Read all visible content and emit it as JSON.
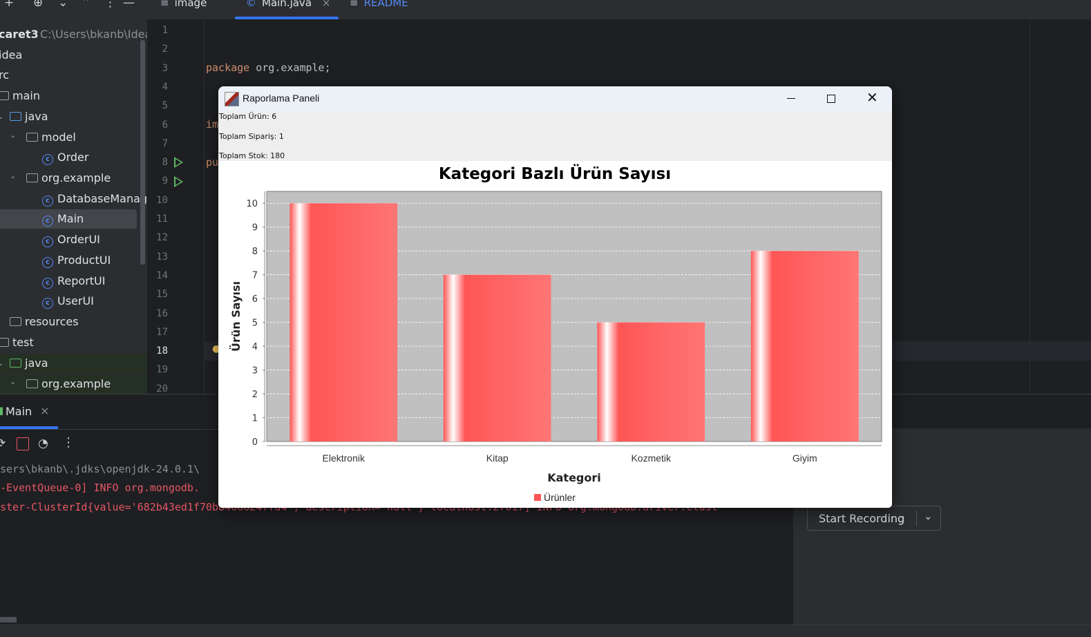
{
  "toolbar": {
    "tabs": [
      {
        "label": "image",
        "icon": "lines-icon"
      },
      {
        "label": "Main.java",
        "icon": "class-icon"
      },
      {
        "label": "README",
        "icon": "lines-icon"
      }
    ]
  },
  "project_tree": {
    "root_label": "caret3",
    "root_path": "C:\\Users\\bkanb\\Idea",
    "items": [
      {
        "label": "idea"
      },
      {
        "label": "rc"
      },
      {
        "label": "main"
      },
      {
        "label": "java"
      },
      {
        "label": "model"
      },
      {
        "label": "Order"
      },
      {
        "label": "org.example"
      },
      {
        "label": "DatabaseManage"
      },
      {
        "label": "Main"
      },
      {
        "label": "OrderUI"
      },
      {
        "label": "ProductUI"
      },
      {
        "label": "ReportUI"
      },
      {
        "label": "UserUI"
      },
      {
        "label": "resources"
      },
      {
        "label": "test"
      },
      {
        "label": "java"
      },
      {
        "label": "org.example"
      }
    ]
  },
  "editor": {
    "line_numbers": [
      "1",
      "2",
      "3",
      "4",
      "5",
      "6",
      "7",
      "8",
      "9",
      "10",
      "11",
      "12",
      "13",
      "14",
      "15",
      "16",
      "17",
      "18",
      "19",
      "20"
    ],
    "current_line": "18",
    "code": {
      "line3_kw": "package",
      "line3_rest": " org.example;",
      "line6": "im",
      "line8": "pu"
    }
  },
  "run_panel": {
    "tab_label": "Main",
    "console": [
      "sers\\bkanb\\.jdks\\openjdk-24.0.1\\",
      "-EventQueue-0] INFO org.mongodb.",
      "ster-ClusterId{value='682b43ed1f70b8466624ffd4', description='null'} localhost:27017] INFO org.mongodb.driver.clust"
    ],
    "recording_button": "Start Recording"
  },
  "dialog": {
    "title": "Raporlama Paneli",
    "stats": {
      "total_products": "Toplam Ürün: 6",
      "total_orders": "Toplam Sipariş: 1",
      "total_stock": "Toplam Stok: 180"
    }
  },
  "colors": {
    "bar": "#ff5555",
    "plot_bg": "#c0c0c0",
    "accent": "#3574f0"
  },
  "chart_data": {
    "type": "bar",
    "title": "Kategori Bazlı Ürün Sayısı",
    "xlabel": "Kategori",
    "ylabel": "Ürün Sayısı",
    "categories": [
      "Elektronik",
      "Kitap",
      "Kozmetik",
      "Giyim"
    ],
    "series": [
      {
        "name": "Ürünler",
        "values": [
          10,
          7,
          5,
          8
        ]
      }
    ],
    "ylim": [
      0,
      10.5
    ],
    "yticks": [
      "0",
      "1",
      "2",
      "3",
      "4",
      "5",
      "6",
      "7",
      "8",
      "9",
      "10"
    ],
    "grid": true,
    "legend": "bottom"
  }
}
